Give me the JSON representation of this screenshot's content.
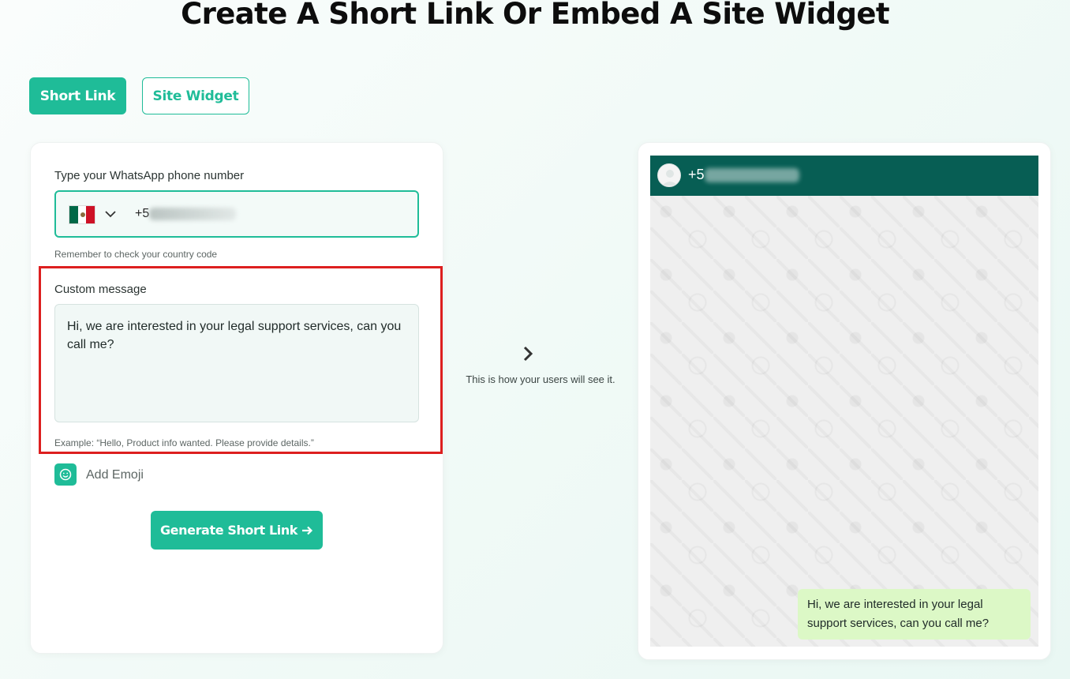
{
  "page": {
    "title": "Create A Short Link Or Embed A Site Widget"
  },
  "tabs": [
    {
      "label": "Short Link",
      "active": true
    },
    {
      "label": "Site Widget",
      "active": false
    }
  ],
  "form": {
    "phone_label": "Type your WhatsApp phone number",
    "country_flag": "mexico-flag-icon",
    "phone_prefix": "+5",
    "phone_hint": "Remember to check your country code",
    "message_label": "Custom message",
    "message_value": "Hi, we are interested in your legal support services, can you call me?",
    "message_example": "Example: “Hello, Product info wanted. Please provide details.”",
    "emoji_label": "Add Emoji",
    "generate_label": "Generate Short Link"
  },
  "preview": {
    "caption": "This is how your users will see it.",
    "header_number_prefix": "+5",
    "bubble_text": "Hi, we are interested in your legal support services, can you call me?"
  },
  "colors": {
    "accent": "#1fbc98",
    "header": "#075e54",
    "bubble": "#dcf8c6",
    "highlight": "#dd1f1f"
  }
}
